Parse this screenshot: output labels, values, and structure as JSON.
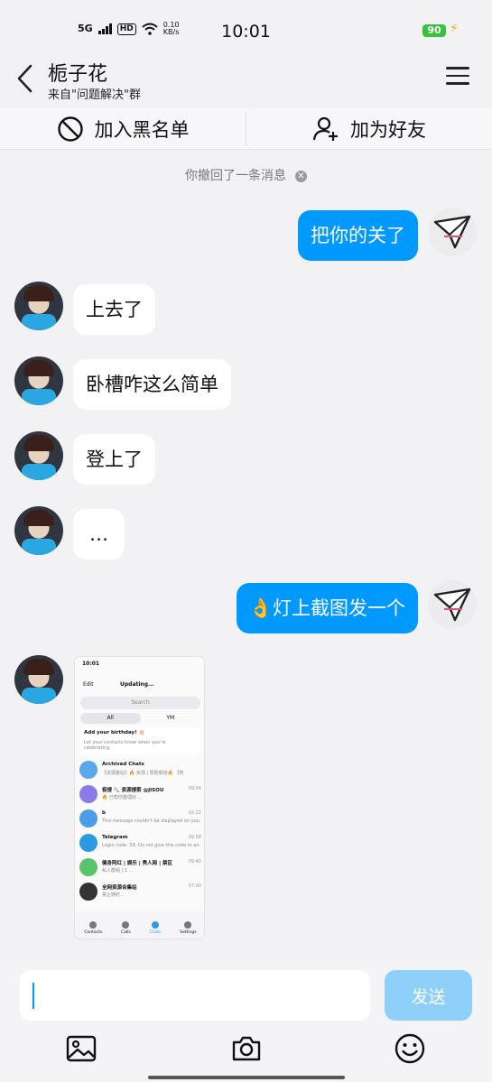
{
  "status_bar": {
    "network": "5G",
    "hd": "HD",
    "speed_value": "0.10",
    "speed_unit": "KB/s",
    "time": "10:01",
    "battery": "90"
  },
  "header": {
    "name": "栀子花",
    "subtitle": "来自\"问题解决\"群"
  },
  "actions": {
    "block_label": "加入黑名单",
    "add_friend_label": "加为好友"
  },
  "notice": {
    "recalled": "你撤回了一条消息"
  },
  "messages": [
    {
      "from": "me",
      "text": "把你的关了"
    },
    {
      "from": "them",
      "text": "上去了"
    },
    {
      "from": "them",
      "text": "卧槽咋这么简单"
    },
    {
      "from": "them",
      "text": "登上了"
    },
    {
      "from": "them",
      "text": "…"
    },
    {
      "from": "me",
      "text": "👌灯上截图发一个"
    }
  ],
  "shared_image": {
    "time": "10:01",
    "edit": "Edit",
    "status": "Updating...",
    "search": "Search",
    "tab_all": "All",
    "tab_ym": "YM",
    "birthday_title": "Add your birthday! 🎂",
    "birthday_text": "Let your contacts know when you're celebrating.",
    "rows": [
      {
        "name": "Archived Chats",
        "preview": "【资源整站】🔥 资源 | 赞助频道🔥 【阿",
        "time": "",
        "color": "#5aa7ea"
      },
      {
        "name": "极搜 🔍 资源搜索 @JISOU",
        "preview": "🔥 已帮你整理好 …",
        "time": "09:04",
        "color": "#8a7be8"
      },
      {
        "name": "b",
        "preview": "This message couldn't be displayed on your device",
        "time": "02:22",
        "color": "#4a9de8"
      },
      {
        "name": "Telegram",
        "preview": "Login code: 59. Do not give this code to anyone",
        "time": "09:58",
        "color": "#2a9be2"
      },
      {
        "name": "健身阿红 | 娱乐 | 秀人网 | 禁区",
        "preview": "私人群组 | 1 …",
        "time": "09:40",
        "color": "#5ac46a"
      },
      {
        "name": "全网资源合集站",
        "preview": "禁止随时…",
        "time": "07:00",
        "color": "#333333"
      }
    ],
    "nav": [
      "Contacts",
      "Calls",
      "Chats",
      "Settings"
    ]
  },
  "composer": {
    "placeholder": "",
    "send_label": "发送"
  },
  "colors": {
    "accent": "#0099ff",
    "send_disabled": "#8fd0fb",
    "background": "#f2f2f5"
  },
  "icons": [
    "back-arrow-icon",
    "menu-icon",
    "block-icon",
    "add-friend-icon",
    "close-icon",
    "image-icon",
    "camera-icon",
    "emoji-icon"
  ]
}
